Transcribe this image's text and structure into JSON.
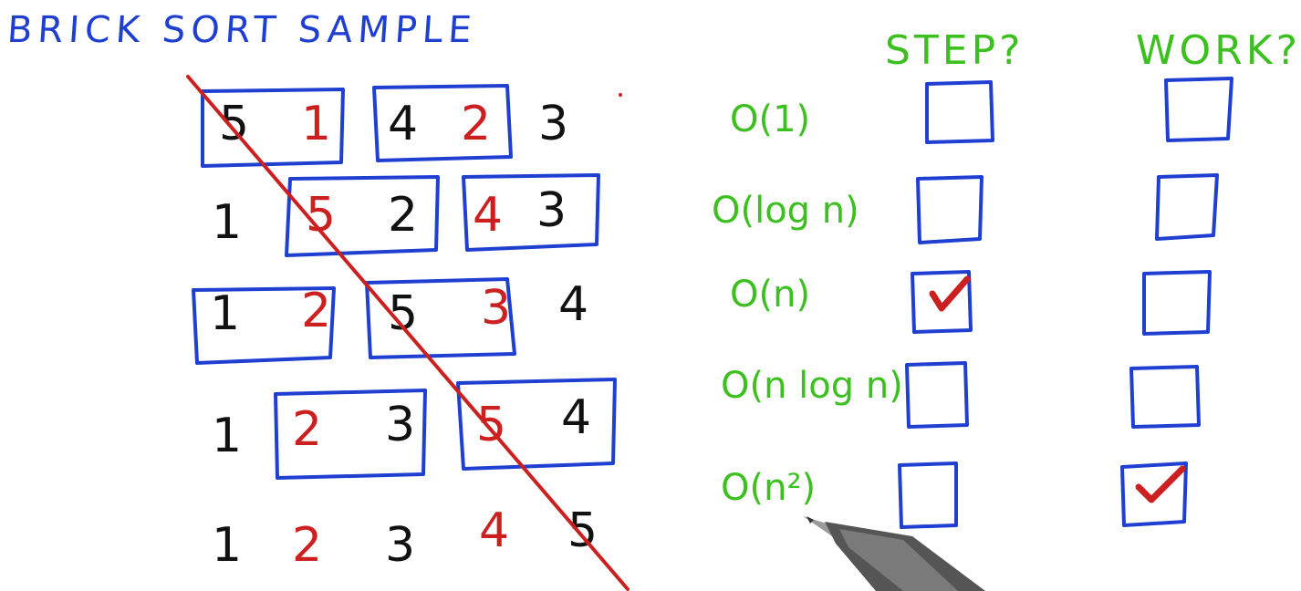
{
  "title": "BRICK SORT SAMPLE",
  "columns": {
    "step": "STEP?",
    "work": "WORK?"
  },
  "rows": [
    {
      "label": "O(1)",
      "step": false,
      "work": false
    },
    {
      "label": "O(log n)",
      "step": false,
      "work": false
    },
    {
      "label": "O(n)",
      "step": true,
      "work": false
    },
    {
      "label": "O(n log n)",
      "step": false,
      "work": false
    },
    {
      "label": "O(n²)",
      "step": false,
      "work": true
    }
  ],
  "passes": [
    [
      "5",
      "1",
      "4",
      "2",
      "3"
    ],
    [
      "1",
      "5",
      "2",
      "4",
      "3"
    ],
    [
      "1",
      "2",
      "5",
      "3",
      "4"
    ],
    [
      "1",
      "2",
      "3",
      "5",
      "4"
    ],
    [
      "1",
      "2",
      "3",
      "4",
      "5"
    ]
  ],
  "colors": {
    "blue": "#1f3fd0",
    "green": "#3cc020",
    "red": "#cc1f1f",
    "black": "#111111"
  },
  "icons": [
    "checkbox-icon",
    "checkmark-icon",
    "pen-icon"
  ]
}
